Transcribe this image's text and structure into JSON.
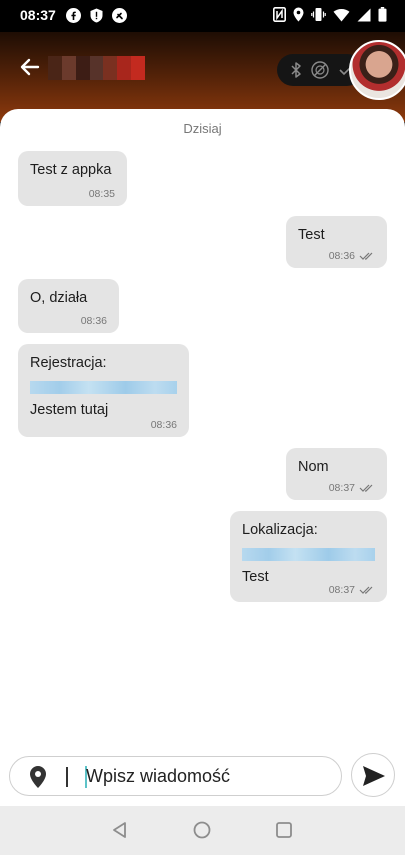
{
  "status_bar": {
    "time": "08:37",
    "left_icons": [
      "facebook-icon",
      "shield-icon",
      "shazam-icon"
    ],
    "right_icons": [
      "nfc-icon",
      "location-icon",
      "vibrate-icon",
      "wifi-icon",
      "signal-icon",
      "battery-icon"
    ]
  },
  "header": {
    "back_icon": "arrow-left-icon",
    "contact_name_obscured": true,
    "pill_icons": [
      "bluetooth-icon",
      "tire-icon",
      "check-icon"
    ]
  },
  "chat": {
    "date_label": "Dzisiaj",
    "messages": [
      {
        "side": "in",
        "text": "Test z appka",
        "time": "08:35"
      },
      {
        "side": "out",
        "text": "Test",
        "time": "08:36",
        "read": true
      },
      {
        "side": "in",
        "text": "O, działa",
        "time": "08:36"
      },
      {
        "side": "in",
        "text": "Rejestracja:",
        "text2": "Jestem tutaj",
        "time": "08:36",
        "has_redacted_line": true
      },
      {
        "side": "out",
        "text": "Nom",
        "time": "08:37",
        "read": true
      },
      {
        "side": "out",
        "text": "Lokalizacja:",
        "text2": "Test",
        "time": "08:37",
        "read": true,
        "has_redacted_line": true
      }
    ]
  },
  "composer": {
    "placeholder": "Wpisz wiadomość",
    "location_icon": "map-pin-icon",
    "send_icon": "send-icon"
  },
  "nav": {
    "icons": [
      "back-triangle-icon",
      "home-circle-icon",
      "recents-square-icon"
    ]
  },
  "colors": {
    "header_dark": "#1e0d04",
    "header_accent": "#8e3a0d",
    "bubble": "#e4e4e4",
    "cursor": "#5dc3c8"
  }
}
